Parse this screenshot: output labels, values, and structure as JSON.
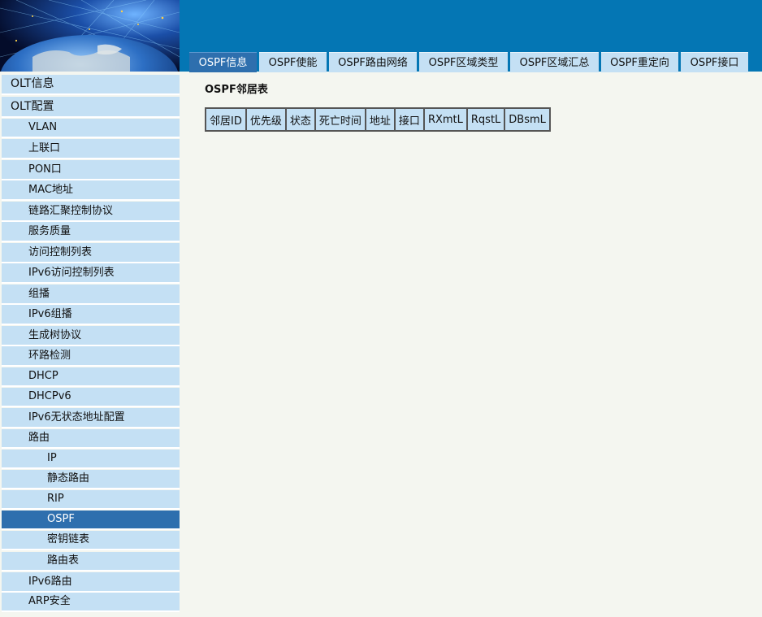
{
  "header": {
    "tabs": [
      {
        "label": "OSPF信息",
        "active": true
      },
      {
        "label": "OSPF使能",
        "active": false
      },
      {
        "label": "OSPF路由网络",
        "active": false
      },
      {
        "label": "OSPF区域类型",
        "active": false
      },
      {
        "label": "OSPF区域汇总",
        "active": false
      },
      {
        "label": "OSPF重定向",
        "active": false
      },
      {
        "label": "OSPF接口",
        "active": false
      }
    ]
  },
  "sidebar": {
    "items": [
      {
        "label": "OLT信息",
        "level": 0
      },
      {
        "label": "OLT配置",
        "level": 0
      },
      {
        "label": "VLAN",
        "level": 1
      },
      {
        "label": "上联口",
        "level": 1
      },
      {
        "label": "PON口",
        "level": 1
      },
      {
        "label": "MAC地址",
        "level": 1
      },
      {
        "label": "链路汇聚控制协议",
        "level": 1
      },
      {
        "label": "服务质量",
        "level": 1
      },
      {
        "label": "访问控制列表",
        "level": 1
      },
      {
        "label": "IPv6访问控制列表",
        "level": 1
      },
      {
        "label": "组播",
        "level": 1
      },
      {
        "label": "IPv6组播",
        "level": 1
      },
      {
        "label": "生成树协议",
        "level": 1
      },
      {
        "label": "环路检测",
        "level": 1
      },
      {
        "label": "DHCP",
        "level": 1
      },
      {
        "label": "DHCPv6",
        "level": 1
      },
      {
        "label": "IPv6无状态地址配置",
        "level": 1
      },
      {
        "label": "路由",
        "level": 1
      },
      {
        "label": "IP",
        "level": 2
      },
      {
        "label": "静态路由",
        "level": 2
      },
      {
        "label": "RIP",
        "level": 2
      },
      {
        "label": "OSPF",
        "level": 2,
        "selected": true
      },
      {
        "label": "密钥链表",
        "level": 2
      },
      {
        "label": "路由表",
        "level": 2
      },
      {
        "label": "IPv6路由",
        "level": 1
      },
      {
        "label": "ARP安全",
        "level": 1
      }
    ]
  },
  "main": {
    "section_title": "OSPF邻居表",
    "table": {
      "columns": [
        "邻居ID",
        "优先级",
        "状态",
        "死亡时间",
        "地址",
        "接口",
        "RXmtL",
        "RqstL",
        "DBsmL"
      ],
      "rows": []
    }
  },
  "colors": {
    "header_blue": "#0476b4",
    "tab_bg": "#c4e0f4",
    "active_tab": "#2e6fae",
    "nav_bg": "#c4e0f4",
    "nav_selected": "#2e6fae",
    "content_bg": "#f4f6f0"
  }
}
